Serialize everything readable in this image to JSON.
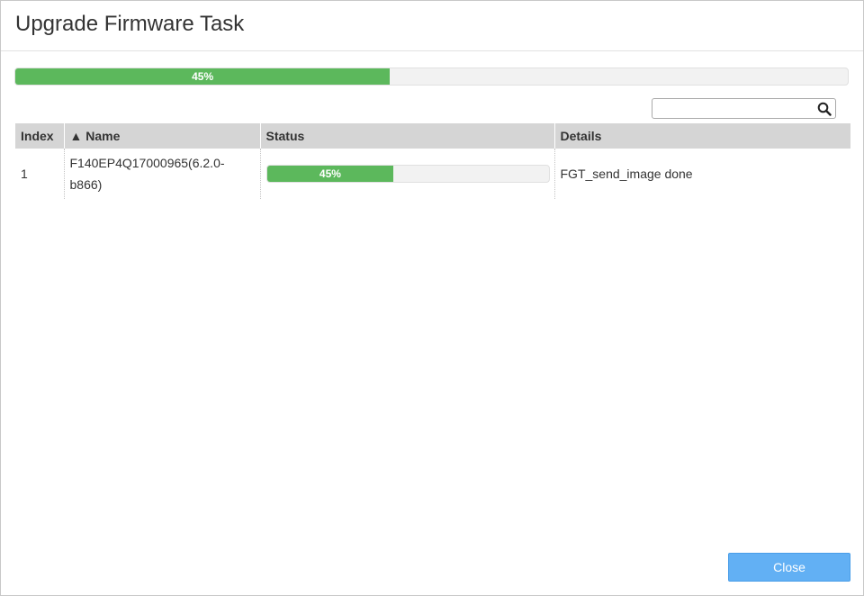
{
  "dialog": {
    "title": "Upgrade Firmware Task",
    "overall_progress": {
      "percent": 45,
      "label": "45%"
    }
  },
  "search": {
    "value": "",
    "placeholder": "",
    "icon": "search-icon"
  },
  "table": {
    "columns": [
      {
        "label": "Index"
      },
      {
        "label": "▲ Name"
      },
      {
        "label": "Status"
      },
      {
        "label": "Details"
      }
    ],
    "rows": [
      {
        "index": "1",
        "name": "F140EP4Q17000965(6.2.0-b866)",
        "status": {
          "percent": 45,
          "label": "45%"
        },
        "details": "FGT_send_image done"
      }
    ]
  },
  "footer": {
    "close_label": "Close"
  },
  "colors": {
    "progress": "#5cb85c",
    "close_button": "#62b0f4",
    "header_bg": "#d5d5d5"
  }
}
